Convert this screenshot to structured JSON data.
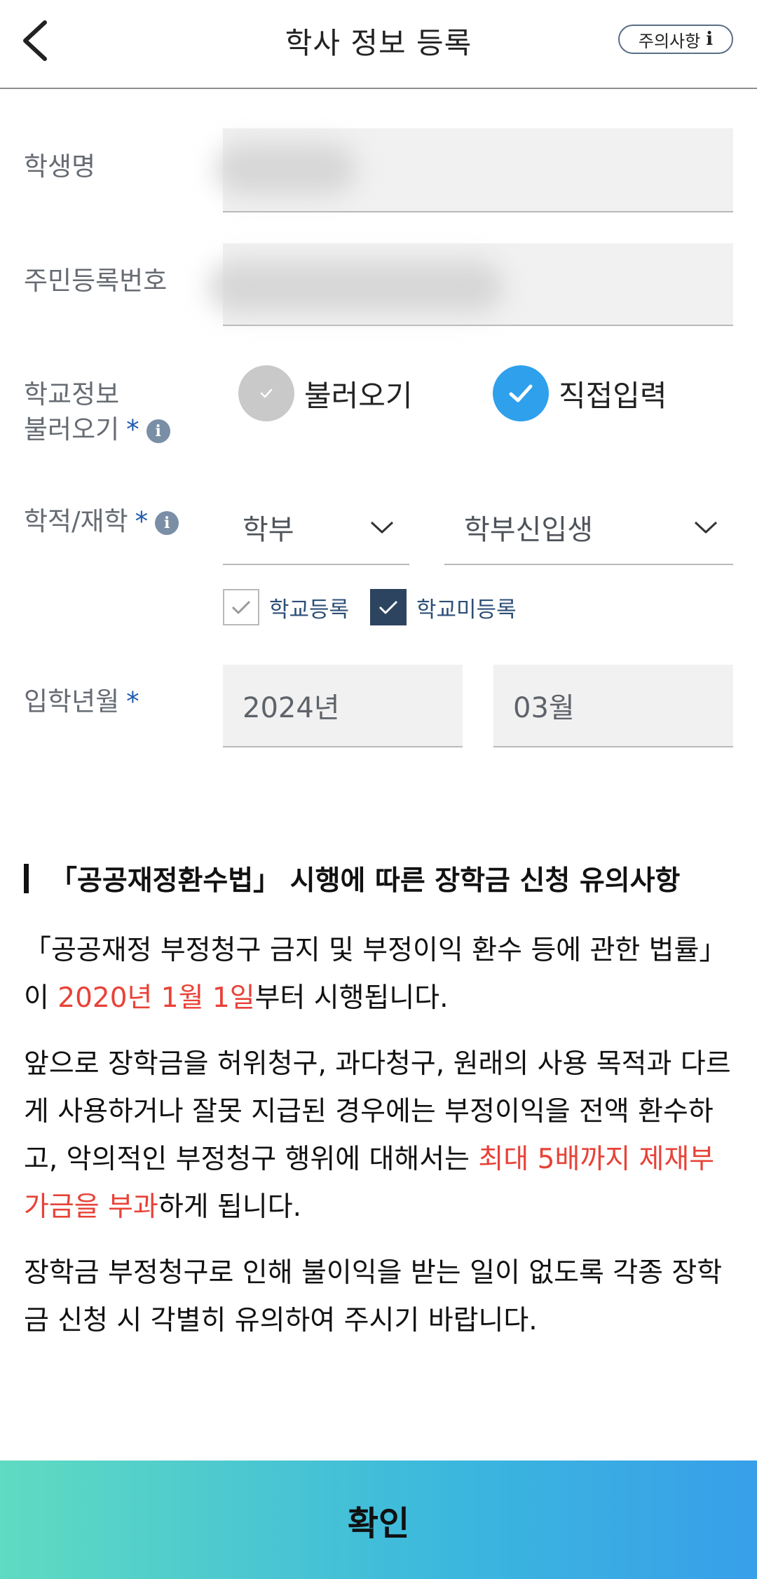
{
  "header": {
    "title": "학사 정보 등록",
    "notice_label": "주의사항",
    "notice_icon": "i"
  },
  "form": {
    "student_name_label": "학생명",
    "resident_number_label": "주민등록번호",
    "school_info_label_line1": "학교정보",
    "school_info_label_line2": "불러오기",
    "required_mark": "*",
    "radio_load": "불러오기",
    "radio_direct": "직접입력",
    "radio_selected": "직접입력",
    "academic_status_label": "학적/재학",
    "select_level": "학부",
    "select_status": "학부신입생",
    "checkbox_registered": "학교등록",
    "checkbox_unregistered": "학교미등록",
    "checkbox_checked": "학교미등록",
    "admission_label": "입학년월",
    "admission_year": "2024년",
    "admission_month": "03월"
  },
  "notice": {
    "title": "「공공재정환수법」 시행에 따른 장학금 신청 유의사항",
    "p1_a": "「공공재정 부정청구 금지 및 부정이익 환수 등에 관한 법률」이 ",
    "p1_red": "2020년 1월 1일",
    "p1_b": "부터 시행됩니다.",
    "p2_a": "앞으로 장학금을 허위청구, 과다청구, 원래의 사용 목적과 다르게 사용하거나 잘못 지급된 경우에는 부정이익을 전액 환수하고, 악의적인 부정청구 행위에 대해서는 ",
    "p2_red": "최대 5배까지 제재부가금을 부과",
    "p2_b": "하게 됩니다.",
    "p3": "장학금 부정청구로 인해 불이익을 받는 일이 없도록 각종 장학금 신청 시 각별히 유의하여 주시기 바랍니다."
  },
  "confirm_label": "확인",
  "colors": {
    "accent_blue": "#2ea0ec",
    "warning_red": "#e84238",
    "checkbox_dark": "#2d4460",
    "button_gradient_start": "#5fdbc1",
    "button_gradient_end": "#389fe9"
  }
}
